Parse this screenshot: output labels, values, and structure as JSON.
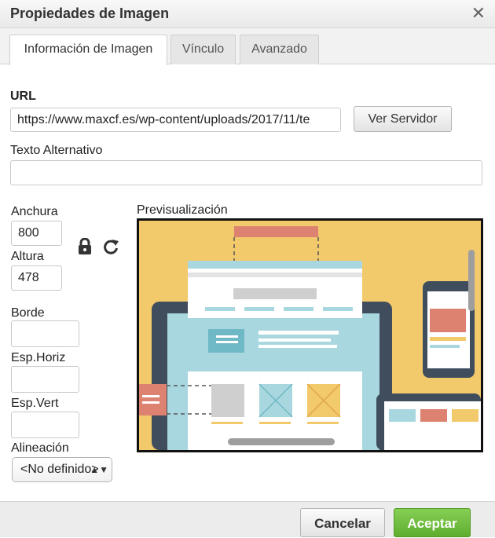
{
  "dialog": {
    "title": "Propiedades de Imagen"
  },
  "icons": {
    "close": "close-icon",
    "lock": "lock-icon",
    "reset": "reset-size-icon",
    "select_arrows": "select-arrows-icon"
  },
  "tabs": [
    {
      "label": "Información de Imagen",
      "active": true
    },
    {
      "label": "Vínculo",
      "active": false
    },
    {
      "label": "Avanzado",
      "active": false
    }
  ],
  "form": {
    "url_label": "URL",
    "url_value": "https://www.maxcf.es/wp-content/uploads/2017/11/te",
    "browse_button": "Ver Servidor",
    "alt_label": "Texto Alternativo",
    "alt_value": "",
    "width_label": "Anchura",
    "width_value": "800",
    "height_label": "Altura",
    "height_value": "478",
    "border_label": "Borde",
    "border_value": "",
    "hspace_label": "Esp.Horiz",
    "hspace_value": "",
    "vspace_label": "Esp.Vert",
    "vspace_value": "",
    "align_label": "Alineación",
    "align_value": "<No definido>"
  },
  "preview": {
    "label": "Previsualización"
  },
  "footer": {
    "cancel": "Cancelar",
    "ok": "Aceptar"
  },
  "colors": {
    "accent_ok": "#6cbf3a",
    "preview_bg": "#f2c96b",
    "preview_blue": "#a9d7df",
    "preview_salmon": "#dd8270",
    "preview_dark": "#3f4d5c"
  }
}
